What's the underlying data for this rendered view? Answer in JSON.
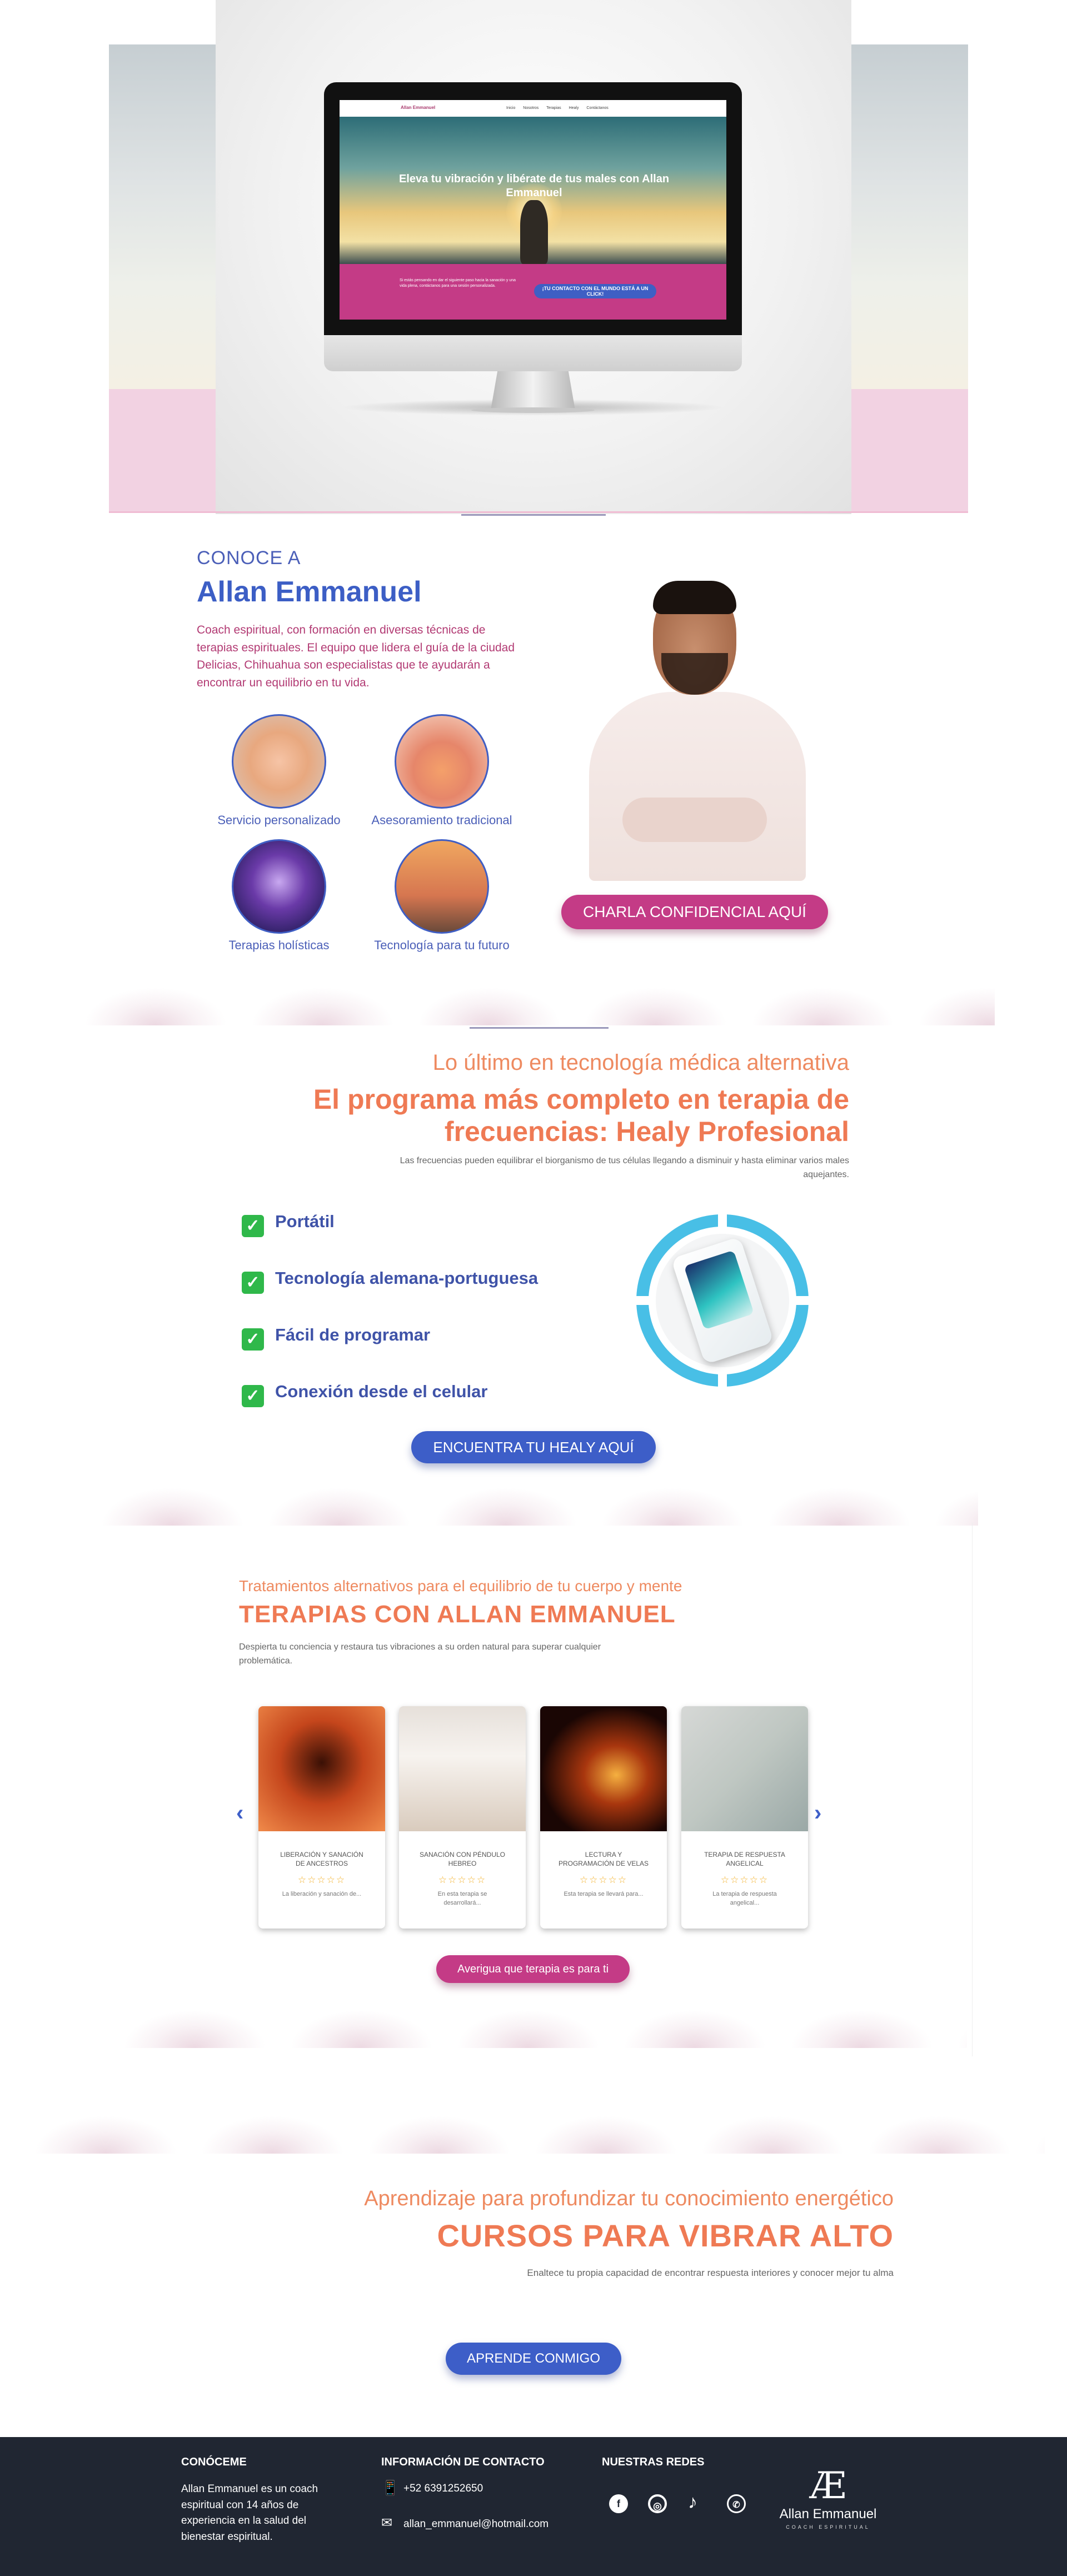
{
  "hero": {
    "nav_logo": "Allan Emmanuel",
    "nav_links": [
      "Inicio",
      "Nosotros",
      "Terapias",
      "Healy",
      "Contáctanos"
    ],
    "headline": "Eleva tu vibración y libérate de tus males con Allan Emmanuel",
    "pink_text": "Si estás pensando en dar el siguiente paso hacia la sanación y una vida plena, contáctanos para una sesión personalizada.",
    "cta": "¡TU CONTACTO CON EL MUNDO ESTÁ A UN CLICK!"
  },
  "about": {
    "eyebrow": "CONOCE A",
    "title": "Allan Emmanuel",
    "text": "Coach espiritual, con formación en diversas técnicas de terapias espirituales. El equipo que lidera el guía de la ciudad Delicias, Chihuahua son especialistas que te ayudarán a encontrar un equilibrio en tu vida.",
    "features": [
      {
        "label": "Servicio personalizado",
        "icon": "hands-image"
      },
      {
        "label": "Asesoramiento tradicional",
        "icon": "dove-hands-image"
      },
      {
        "label": "Terapias holísticas",
        "icon": "chakra-body-image"
      },
      {
        "label": "Tecnología para tu futuro",
        "icon": "meditation-sunset-image"
      }
    ],
    "cta": "CHARLA CONFIDENCIAL AQUÍ"
  },
  "healy": {
    "eyebrow": "Lo último en tecnología médica alternativa",
    "title_line1": "El programa más completo en terapia de",
    "title_line2": "frecuencias: Healy Profesional",
    "subtitle": "Las frecuencias pueden equilibrar el biorganismo de tus células llegando a disminuir y hasta eliminar varios males aquejantes.",
    "features": [
      "Portátil",
      "Tecnología alemana-portuguesa",
      "Fácil de programar",
      "Conexión desde el celular"
    ],
    "cta": "ENCUENTRA TU HEALY AQUÍ"
  },
  "therapies": {
    "eyebrow": "Tratamientos alternativos para el equilibrio de tu cuerpo y mente",
    "title": "TERAPIAS CON ALLAN EMMANUEL",
    "subtitle": "Despierta tu conciencia y restaura tus vibraciones a su orden natural para superar cualquier problemática.",
    "cards": [
      {
        "title": "LIBERACIÓN Y SANACIÓN DE ANCESTROS",
        "stars": "☆☆☆☆☆",
        "desc": "La liberación y sanación de..."
      },
      {
        "title": "SANACIÓN CON PÉNDULO HEBREO",
        "stars": "☆☆☆☆☆",
        "desc": "En esta terapia se desarrollará..."
      },
      {
        "title": "LECTURA Y PROGRAMACIÓN DE VELAS",
        "stars": "☆☆☆☆☆",
        "desc": "Esta terapia se llevará para..."
      },
      {
        "title": "TERAPIA DE RESPUESTA ANGELICAL",
        "stars": "☆☆☆☆☆",
        "desc": "La terapia de respuesta angelical..."
      }
    ],
    "cta": "Averigua que terapia es para ti"
  },
  "courses": {
    "eyebrow": "Aprendizaje para profundizar tu conocimiento energético",
    "title": "CURSOS PARA VIBRAR ALTO",
    "subtitle": "Enaltece tu propia capacidad de encontrar respuesta interiores y conocer mejor tu alma",
    "cta": "APRENDE CONMIGO"
  },
  "footer": {
    "about_heading": "CONÓCEME",
    "about_text": "Allan Emmanuel es un coach espiritual con 14 años de experiencia en la salud del bienestar espiritual.",
    "contact_heading": "INFORMACIÓN DE CONTACTO",
    "phone": "+52 6391252650",
    "email": "allan_emmanuel@hotmail.com",
    "social_heading": "NUESTRAS REDES",
    "social_icons": [
      "facebook-icon",
      "instagram-icon",
      "tiktok-icon",
      "whatsapp-icon"
    ],
    "logo_name": "Allan Emmanuel",
    "logo_tag": "COACH ESPIRITUAL"
  },
  "colors": {
    "brand_blue": "#3d5ec8",
    "brand_pink": "#c43b86",
    "accent_orange": "#ef7a54",
    "footer_bg": "#202632"
  }
}
